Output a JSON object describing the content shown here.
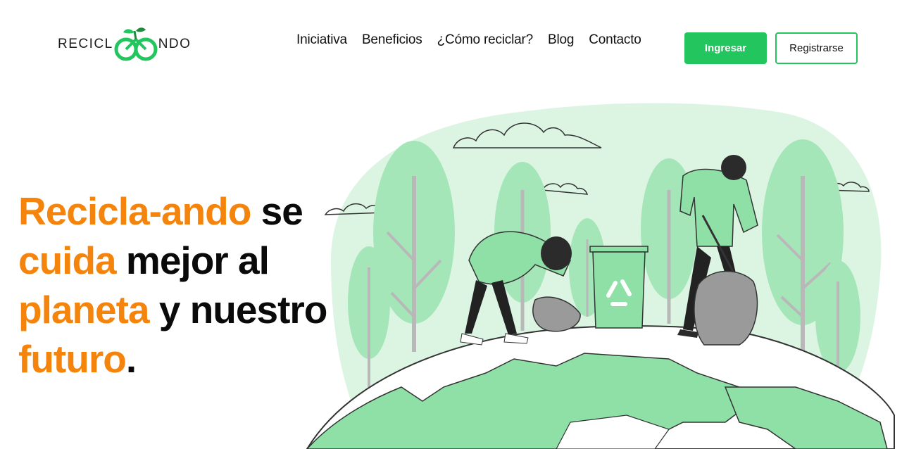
{
  "brand": {
    "logo_left": "RECICL",
    "logo_right": "NDO"
  },
  "nav": {
    "items": [
      {
        "label": "Iniciativa"
      },
      {
        "label": "Beneficios"
      },
      {
        "label": "¿Cómo reciclar?"
      },
      {
        "label": "Blog"
      },
      {
        "label": "Contacto"
      }
    ],
    "login_label": "Ingresar",
    "register_label": "Registrarse"
  },
  "hero": {
    "segments": {
      "s1": "Recicla-ando",
      "s2": " se",
      "s3": "cuida",
      "s4": " mejor al",
      "s5": "planeta",
      "s6": " y nuestro",
      "s7": "futuro",
      "s8": "."
    }
  },
  "colors": {
    "accent_green": "#22c55e",
    "highlight_orange": "#f5840c",
    "illustration_green": "#8fe0a6",
    "illustration_light": "#dcf5e3"
  },
  "icons": {
    "recycle": "recycle-icon",
    "logo": "bike-leaf-logo"
  }
}
